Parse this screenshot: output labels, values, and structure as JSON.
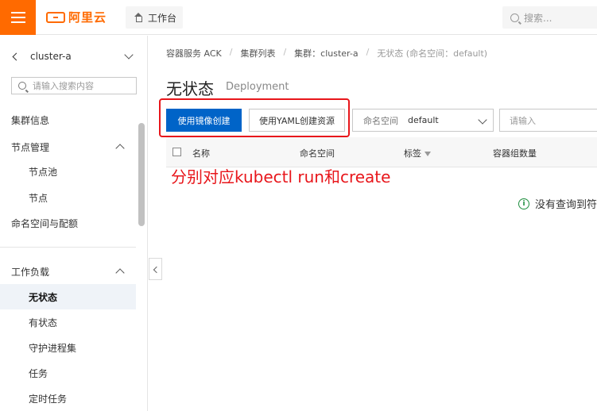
{
  "topbar": {
    "logo_text": "阿里云",
    "workbench_label": "工作台",
    "search_placeholder": "搜索..."
  },
  "sidebar": {
    "cluster_name": "cluster-a",
    "search_placeholder": "请输入搜索内容",
    "items": [
      {
        "label": "集群信息"
      },
      {
        "label": "节点管理"
      },
      {
        "label": "节点池"
      },
      {
        "label": "节点"
      },
      {
        "label": "命名空间与配额"
      },
      {
        "label": "工作负载"
      },
      {
        "label": "无状态"
      },
      {
        "label": "有状态"
      },
      {
        "label": "守护进程集"
      },
      {
        "label": "任务"
      },
      {
        "label": "定时任务"
      }
    ]
  },
  "breadcrumb": {
    "items": [
      "容器服务 ACK",
      "集群列表",
      "集群：cluster-a",
      "无状态 (命名空间：default)"
    ],
    "separator": "/"
  },
  "page": {
    "title": "无状态",
    "subtitle": "Deployment"
  },
  "toolbar": {
    "create_image_label": "使用镜像创建",
    "create_yaml_label": "使用YAML创建资源",
    "namespace_label": "命名空间",
    "namespace_value": "default",
    "filter_placeholder": "请输入"
  },
  "table": {
    "columns": [
      "名称",
      "命名空间",
      "标签",
      "容器组数量"
    ]
  },
  "annotation": {
    "text": "分别对应kubectl run和create",
    "color": "#e8161b"
  },
  "empty_state": {
    "text": "没有查询到符"
  },
  "colors": {
    "brand": "#ff6a00",
    "primary": "#0064c8",
    "highlight": "#e8161b",
    "info": "#1e8e3e"
  }
}
